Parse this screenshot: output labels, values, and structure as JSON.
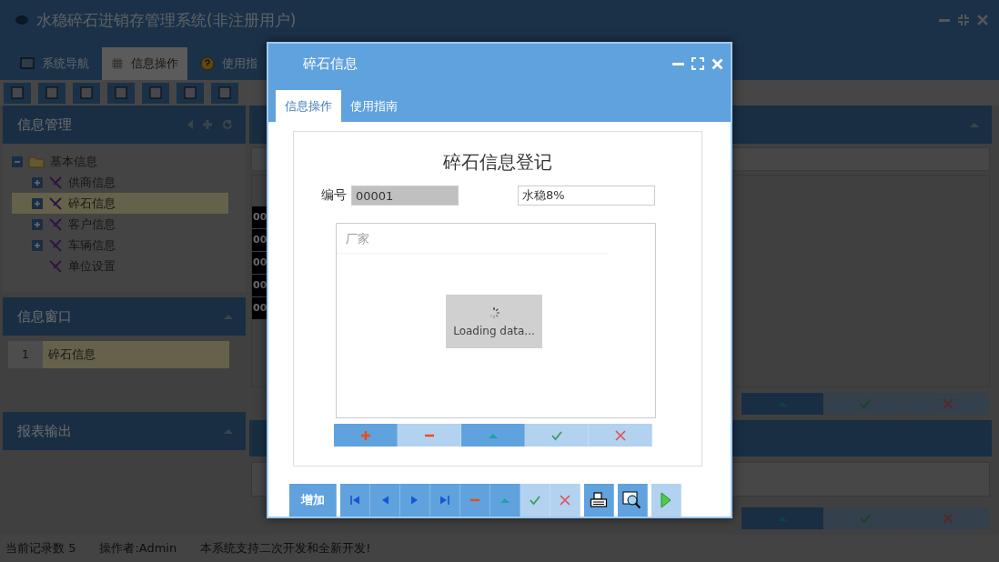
{
  "app": {
    "title": "水稳碎石进销存管理系统(非注册用户)"
  },
  "main_tabs": [
    {
      "label": "系统导航",
      "kind": "monitor",
      "selected": false
    },
    {
      "label": "信息操作",
      "kind": "grid",
      "selected": true
    },
    {
      "label": "使用指",
      "kind": "help",
      "selected": false
    }
  ],
  "sidebar": {
    "nav_title": "信息管理",
    "tree": [
      {
        "label": "基本信息",
        "expanded": true,
        "children": [
          {
            "label": "供商信息",
            "expanded": false,
            "selected": false
          },
          {
            "label": "碎石信息",
            "expanded": false,
            "selected": true
          },
          {
            "label": "客户信息",
            "expanded": false,
            "selected": false
          },
          {
            "label": "车辆信息",
            "expanded": false,
            "selected": false
          },
          {
            "label": "单位设置",
            "selected": false
          }
        ]
      }
    ],
    "window_title": "信息窗口",
    "windows": [
      {
        "index": "1",
        "label": "碎石信息",
        "selected": true
      }
    ],
    "report_title": "报表输出"
  },
  "records": {
    "cells": [
      "00",
      "00",
      "00",
      "00",
      "00"
    ]
  },
  "record_toolbar": [
    {
      "kind": "up",
      "disabled": false
    },
    {
      "kind": "confirm",
      "disabled": true
    },
    {
      "kind": "cancel",
      "disabled": true
    }
  ],
  "detail_toolbar": [
    {
      "kind": "up",
      "disabled": false
    },
    {
      "kind": "confirm",
      "disabled": true
    },
    {
      "kind": "cancel",
      "disabled": true
    }
  ],
  "status_bar": [
    "当前记录数 5",
    "操作者:Admin",
    "本系统支持二次开发和全新开发!"
  ],
  "dialog": {
    "title": "碎石信息",
    "tabs": [
      {
        "label": "信息操作",
        "selected": true
      },
      {
        "label": "使用指南",
        "selected": false
      }
    ],
    "form_title": "碎石信息登记",
    "fields": [
      {
        "label": "编号",
        "value": "00001",
        "disabled": true
      },
      {
        "value": "水稳8%",
        "disabled": false
      }
    ],
    "grid": {
      "columns": [
        "厂家"
      ],
      "loading_text": "Loading data..."
    },
    "grid_toolbar": [
      {
        "kind": "add",
        "disabled": false
      },
      {
        "kind": "remove",
        "disabled": true
      },
      {
        "kind": "up",
        "disabled": false
      },
      {
        "kind": "confirm",
        "disabled": true
      },
      {
        "kind": "cancel",
        "disabled": true
      }
    ],
    "toolbar": [
      {
        "kind": "text",
        "label": "增加",
        "disabled": false
      },
      {
        "kind": "first",
        "disabled": false
      },
      {
        "kind": "prev",
        "disabled": false
      },
      {
        "kind": "next",
        "disabled": false
      },
      {
        "kind": "last",
        "disabled": false
      },
      {
        "kind": "remove",
        "disabled": false
      },
      {
        "kind": "up",
        "disabled": false
      },
      {
        "kind": "confirm",
        "disabled": true
      },
      {
        "kind": "cancel",
        "disabled": true
      },
      {
        "kind": "print",
        "disabled": false
      },
      {
        "kind": "preview",
        "disabled": false
      },
      {
        "kind": "run",
        "disabled": true
      }
    ]
  }
}
